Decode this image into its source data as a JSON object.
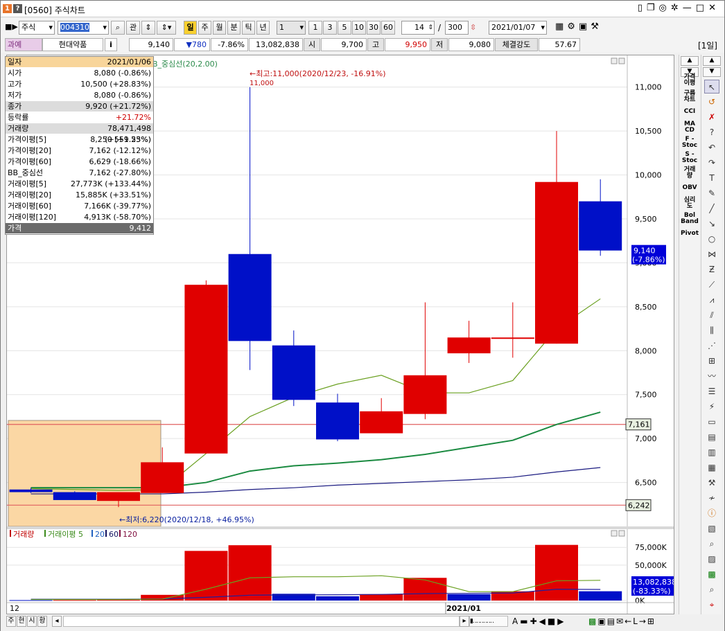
{
  "window": {
    "badge_1": "1",
    "badge_2": "?",
    "title": "[0560] 주식차트"
  },
  "toolbar": {
    "market_select": "주식",
    "code_input": "004310",
    "favorites_label": "관",
    "period_buttons": [
      "일",
      "주",
      "월",
      "분",
      "틱",
      "년"
    ],
    "interval_select": "1",
    "interval_presets": [
      "1",
      "3",
      "5",
      "10",
      "30",
      "60"
    ],
    "display_count": "14",
    "count_separator": "/",
    "max_count": "300",
    "date_input": "2021/01/07"
  },
  "stock_info": {
    "tag": "과예",
    "name": "현대약품",
    "info_label": "i",
    "price": "9,140",
    "change": "▼780",
    "change_pct": "-7.86%",
    "volume": "13,082,838",
    "open_label": "시",
    "open": "9,700",
    "high_label": "고",
    "high": "9,950",
    "low_label": "저",
    "low": "9,080",
    "strength_label": "체결강도",
    "strength": "57.67",
    "period_badge": "[1일]"
  },
  "data_window": {
    "header_label": "일자",
    "header_value": "2021/01/06",
    "rows": [
      {
        "label": "시가",
        "value": "8,080 (-0.86%)"
      },
      {
        "label": "고가",
        "value": "10,500 (+28.83%)"
      },
      {
        "label": "저가",
        "value": "8,080 (-0.86%)"
      },
      {
        "label": "종가",
        "value": "9,920 (+21.72%)"
      },
      {
        "label": "등락률",
        "value": "+21.72%"
      },
      {
        "label": "거래량",
        "value": "78,471,498 (+559.55%)"
      },
      {
        "label": "가격이평[5]",
        "value": "8,250 (+1.23%)"
      },
      {
        "label": "가격이평[20]",
        "value": "7,162 (-12.12%)"
      },
      {
        "label": "가격이평[60]",
        "value": "6,629 (-18.66%)"
      },
      {
        "label": "BB_중심선",
        "value": "7,162 (-27.80%)"
      },
      {
        "label": "거래이평[5]",
        "value": "27,773K (+133.44%)"
      },
      {
        "label": "거래이평[20]",
        "value": "15,885K (+33.51%)"
      },
      {
        "label": "거래이평[60]",
        "value": "7,166K (-39.77%)"
      },
      {
        "label": "거래이평[120]",
        "value": "4,913K (-58.70%)"
      }
    ],
    "footer_label": "가격",
    "footer_value": "9,412"
  },
  "chart_data": [
    {
      "type": "candlestick",
      "legend": "B_중심선(20,2.00)",
      "y_ticks": [
        "11,000",
        "10,500",
        "10,000",
        "9,500",
        "9,000",
        "8,500",
        "8,000",
        "7,500",
        "7,000",
        "6,500"
      ],
      "ylim": [
        6000,
        11250
      ],
      "x_labels": [
        "12",
        "2021/01"
      ],
      "candles": [
        {
          "o": 6420,
          "h": 6440,
          "l": 6380,
          "c": 6390,
          "color": "blue"
        },
        {
          "o": 6390,
          "h": 6400,
          "l": 6300,
          "c": 6300,
          "color": "blue"
        },
        {
          "o": 6290,
          "h": 6390,
          "l": 6220,
          "c": 6390,
          "color": "red"
        },
        {
          "o": 6380,
          "h": 6900,
          "l": 6380,
          "c": 6730,
          "color": "red"
        },
        {
          "o": 6830,
          "h": 8800,
          "l": 6830,
          "c": 8750,
          "color": "red"
        },
        {
          "o": 9100,
          "h": 11000,
          "l": 7780,
          "c": 8110,
          "color": "blue"
        },
        {
          "o": 8060,
          "h": 8230,
          "l": 7370,
          "c": 7440,
          "color": "blue"
        },
        {
          "o": 7410,
          "h": 7510,
          "l": 6970,
          "c": 6990,
          "color": "blue"
        },
        {
          "o": 7060,
          "h": 7460,
          "l": 7060,
          "c": 7310,
          "color": "red"
        },
        {
          "o": 7280,
          "h": 8550,
          "l": 7220,
          "c": 7720,
          "color": "red"
        },
        {
          "o": 7970,
          "h": 8340,
          "l": 7860,
          "c": 8150,
          "color": "red"
        },
        {
          "o": 8150,
          "h": 8550,
          "l": 7920,
          "c": 8150,
          "color": "red"
        },
        {
          "o": 8080,
          "h": 10500,
          "l": 8080,
          "c": 9920,
          "color": "red"
        },
        {
          "o": 9700,
          "h": 9950,
          "l": 9080,
          "c": 9140,
          "color": "blue"
        }
      ],
      "ma5": [
        6430,
        6420,
        6410,
        6420,
        6830,
        7250,
        7470,
        7620,
        7720,
        7520,
        7520,
        7660,
        8250,
        8590
      ],
      "ma20": [
        6440,
        6440,
        6440,
        6440,
        6500,
        6630,
        6690,
        6720,
        6760,
        6820,
        6900,
        6980,
        7160,
        7300
      ],
      "ma60": [
        6370,
        6370,
        6370,
        6370,
        6390,
        6420,
        6440,
        6470,
        6490,
        6510,
        6530,
        6560,
        6620,
        6670
      ],
      "hlines": [
        {
          "value": 7161,
          "label": "7,161"
        },
        {
          "value": 6242,
          "label": "6,242"
        }
      ],
      "current_price_label": "9,140",
      "current_pct_label": "(-7.86%)",
      "high_annotation": "←최고:11,000(2020/12/23, -16.91%)",
      "high_value_label": "11,000",
      "low_annotation": "←최저:6,220(2020/12/18, +46.95%)"
    },
    {
      "type": "bar",
      "legend": [
        "거래량",
        "거래이평 5",
        "20",
        "60",
        "120"
      ],
      "y_ticks": [
        "75,000K",
        "50,000K",
        "0K"
      ],
      "ylim": [
        0,
        85000
      ],
      "volume_k": [
        600,
        700,
        900,
        8000,
        70000,
        78000,
        9500,
        6000,
        9000,
        32000,
        9000,
        13000,
        78471,
        13083
      ],
      "volume_colors": [
        "blue",
        "red",
        "red",
        "red",
        "red",
        "red",
        "blue",
        "blue",
        "red",
        "red",
        "blue",
        "red",
        "red",
        "blue"
      ],
      "ma5_k": [
        1500,
        1500,
        1500,
        2000,
        16000,
        32000,
        33500,
        33500,
        35000,
        29000,
        12500,
        12500,
        27773,
        28500
      ],
      "ma20_k": [
        1800,
        1800,
        1800,
        2200,
        4500,
        7500,
        8000,
        8200,
        8600,
        9800,
        10200,
        10600,
        15885,
        15600
      ],
      "current_label": "13,082,838",
      "current_pct_label": "(-83.33%)"
    }
  ],
  "right_panel": {
    "items": [
      "가격\n이평",
      "구름\n차트",
      "CCI",
      "MA\nCD",
      "F -\nStoc",
      "S -\nStoc",
      "거래\n량",
      "OBV",
      "심리\n도",
      "Bol\nBand",
      "Pivot"
    ]
  },
  "bottom_bar": {
    "tabs": [
      "주",
      "현",
      "시",
      "황"
    ]
  }
}
